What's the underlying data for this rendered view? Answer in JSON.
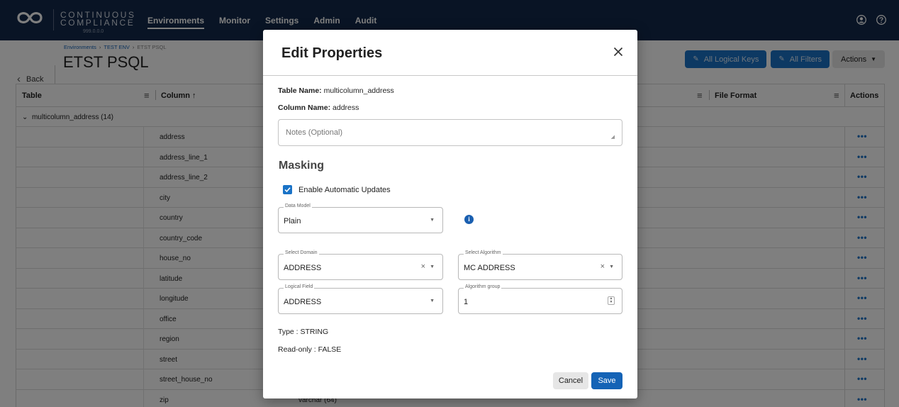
{
  "brand": {
    "line1": "CONTINUOUS",
    "line2": "COMPLIANCE",
    "version": "999.0.0.0"
  },
  "nav": {
    "items": [
      "Environments",
      "Monitor",
      "Settings",
      "Admin",
      "Audit"
    ],
    "active": "Environments"
  },
  "header": {
    "back_label": "Back",
    "breadcrumb": [
      "Environments",
      "TEST ENV",
      "ETST PSQL"
    ],
    "title": "ETST PSQL",
    "btn_logical_keys": "All Logical Keys",
    "btn_filters": "All Filters",
    "btn_actions": "Actions"
  },
  "table": {
    "headers": {
      "table": "Table",
      "column": "Column ↑",
      "file_format": "File Format",
      "actions": "Actions"
    },
    "group_label": "multicolumn_address (14)",
    "rows": [
      {
        "column": "address",
        "type": ""
      },
      {
        "column": "address_line_1",
        "type": ""
      },
      {
        "column": "address_line_2",
        "type": ""
      },
      {
        "column": "city",
        "type": ""
      },
      {
        "column": "country",
        "type": ""
      },
      {
        "column": "country_code",
        "type": ""
      },
      {
        "column": "house_no",
        "type": ""
      },
      {
        "column": "latitude",
        "type": ""
      },
      {
        "column": "longitude",
        "type": ""
      },
      {
        "column": "office",
        "type": ""
      },
      {
        "column": "region",
        "type": ""
      },
      {
        "column": "street",
        "type": ""
      },
      {
        "column": "street_house_no",
        "type": ""
      },
      {
        "column": "zip",
        "type": "varchar (64)"
      }
    ],
    "row_action": "•••"
  },
  "modal": {
    "title": "Edit Properties",
    "table_name_label": "Table Name:",
    "table_name": "multicolumn_address",
    "column_name_label": "Column Name:",
    "column_name": "address",
    "notes_placeholder": "Notes (Optional)",
    "section_title": "Masking",
    "auto_updates_label": "Enable Automatic Updates",
    "auto_updates_checked": true,
    "data_model": {
      "label": "Data Model",
      "value": "Plain"
    },
    "domain": {
      "label": "Select Domain",
      "value": "ADDRESS"
    },
    "algorithm": {
      "label": "Select Algorithm",
      "value": "MC ADDRESS"
    },
    "logical_field": {
      "label": "Logical Field",
      "value": "ADDRESS"
    },
    "algorithm_group": {
      "label": "Algorithm group",
      "value": "1"
    },
    "type_line": "Type : STRING",
    "readonly_line": "Read-only : FALSE",
    "cancel_label": "Cancel",
    "save_label": "Save"
  },
  "colors": {
    "topbar": "#12294a",
    "accent": "#1a73c7",
    "save": "#1463b6"
  }
}
